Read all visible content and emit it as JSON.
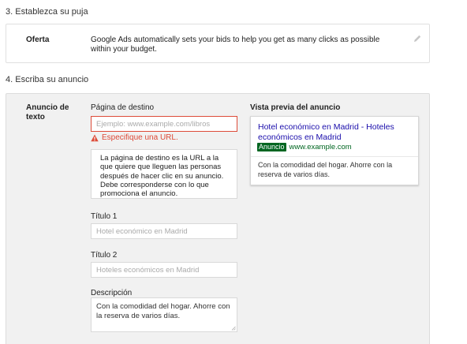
{
  "step3": {
    "title": "3. Establezca su puja"
  },
  "bid": {
    "label": "Oferta",
    "text": "Google Ads automatically sets your bids to help you get as many clicks as possible within your budget."
  },
  "step4": {
    "title": "4. Escriba su anuncio"
  },
  "ad": {
    "section_label": "Anuncio de texto",
    "destination": {
      "label": "Página de destino",
      "placeholder": "Ejemplo: www.example.com/libros",
      "error": "Especifique una URL.",
      "help": "La página de destino es la URL a la que quiere que lleguen las personas después de hacer clic en su anuncio. Debe corresponderse con lo que promociona el anuncio."
    },
    "title1": {
      "label": "Título 1",
      "placeholder": "Hotel económico en Madrid"
    },
    "title2": {
      "label": "Título 2",
      "placeholder": "Hoteles económicos en Madrid"
    },
    "description": {
      "label": "Descripción",
      "value": "Con la comodidad del hogar. Ahorre con la reserva de varios días."
    }
  },
  "preview": {
    "label": "Vista previa del anuncio",
    "headline": "Hotel económico en Madrid - Hoteles económicos en Madrid",
    "badge": "Anuncio",
    "url": "www.example.com",
    "description": "Con la comodidad del hogar. Ahorre con la reserva de varios días."
  },
  "icons": {
    "edit": "pencil-icon",
    "warning": "warning-icon"
  },
  "colors": {
    "error": "#dd4b39",
    "link": "#1a0dab",
    "url_green": "#006621",
    "panel_bg": "#f1f1f1"
  }
}
